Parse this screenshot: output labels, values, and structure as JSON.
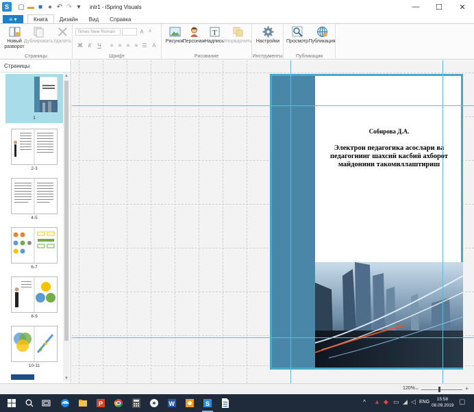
{
  "window": {
    "app_icon": "ispring-app-icon",
    "title": "intr1 - iSpring Visuals",
    "controls": {
      "minimize": "—",
      "maximize": "☐",
      "close": "✕"
    }
  },
  "ribbon_tabs": {
    "file_label": "≡ ▾",
    "tabs": [
      {
        "label": "Книга",
        "active": true
      },
      {
        "label": "Дизайн",
        "active": false
      },
      {
        "label": "Вид",
        "active": false
      },
      {
        "label": "Справка",
        "active": false
      }
    ]
  },
  "ribbon": {
    "pages_group": {
      "label": "Страницы",
      "new_spread": "Новый разворот",
      "duplicate": "Дублировать",
      "delete": "Удалить"
    },
    "font_group": {
      "label": "Шрифт",
      "font_name_placeholder": "Times New Roman"
    },
    "drawing_group": {
      "label": "Рисование",
      "picture": "Рисунок",
      "character": "Персонаж",
      "textbox": "Надпись",
      "arrange": "Упорядочить"
    },
    "tools_group": {
      "label": "Инструменты",
      "settings": "Настройки"
    },
    "publish_group": {
      "label": "Публикация",
      "preview": "Просмотр",
      "publish": "Публикация"
    }
  },
  "pages_panel": {
    "title": "Страницы",
    "thumbnails": [
      {
        "label": "1",
        "selected": true
      },
      {
        "label": "2-3",
        "selected": false
      },
      {
        "label": "4-5",
        "selected": false
      },
      {
        "label": "6-7",
        "selected": false
      },
      {
        "label": "8-9",
        "selected": false
      },
      {
        "label": "10-11",
        "selected": false
      }
    ]
  },
  "cover": {
    "author": "Собирова Д.А.",
    "title": "Электрон педагогика асослари ва педагогнинг шахсий касбий ахборот майдонини такомиллаштириш",
    "band_color": "#4a86a8",
    "frame_color": "#47a9c9"
  },
  "status_bar": {
    "zoom_level": "120%",
    "zoom_out": "−",
    "zoom_in": "+"
  },
  "taskbar": {
    "language": "ENG",
    "time": "15:58",
    "date": "08.09.2019"
  }
}
